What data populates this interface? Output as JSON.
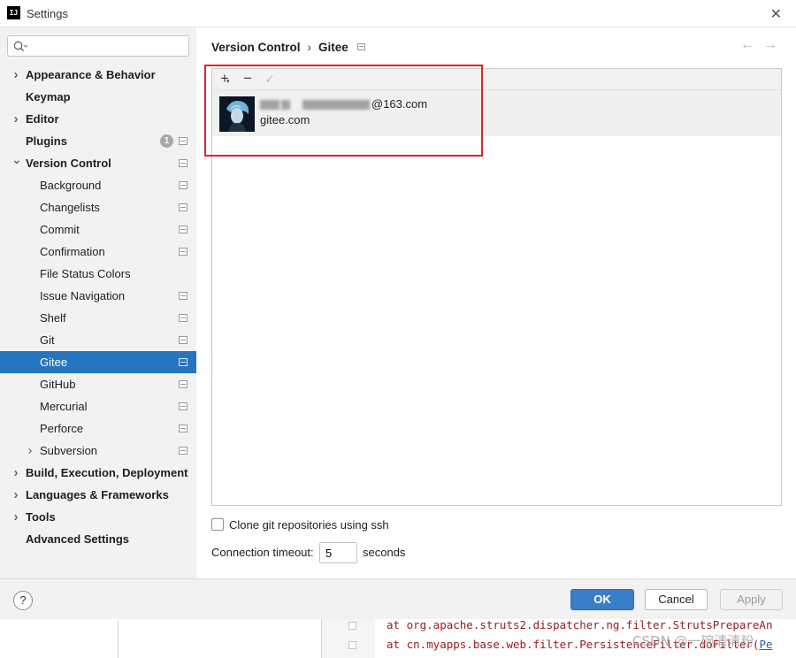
{
  "window": {
    "title": "Settings",
    "logo_text": "IJ"
  },
  "sidebar": {
    "search_placeholder": "",
    "items": [
      {
        "label": "Appearance & Behavior",
        "level": 0,
        "bold": true,
        "expandable": true,
        "expanded": false
      },
      {
        "label": "Keymap",
        "level": 0,
        "bold": true
      },
      {
        "label": "Editor",
        "level": 0,
        "bold": true,
        "expandable": true,
        "expanded": false
      },
      {
        "label": "Plugins",
        "level": 0,
        "bold": true,
        "badge": "1",
        "project": true
      },
      {
        "label": "Version Control",
        "level": 0,
        "bold": true,
        "expandable": true,
        "expanded": true,
        "project": true
      },
      {
        "label": "Background",
        "level": 1,
        "project": true
      },
      {
        "label": "Changelists",
        "level": 1,
        "project": true
      },
      {
        "label": "Commit",
        "level": 1,
        "project": true
      },
      {
        "label": "Confirmation",
        "level": 1,
        "project": true
      },
      {
        "label": "File Status Colors",
        "level": 1
      },
      {
        "label": "Issue Navigation",
        "level": 1,
        "project": true
      },
      {
        "label": "Shelf",
        "level": 1,
        "project": true
      },
      {
        "label": "Git",
        "level": 1,
        "project": true
      },
      {
        "label": "Gitee",
        "level": 1,
        "project": true,
        "selected": true
      },
      {
        "label": "GitHub",
        "level": 1,
        "project": true
      },
      {
        "label": "Mercurial",
        "level": 1,
        "project": true
      },
      {
        "label": "Perforce",
        "level": 1,
        "project": true
      },
      {
        "label": "Subversion",
        "level": 1,
        "expandable": true,
        "expanded": false,
        "project": true
      },
      {
        "label": "Build, Execution, Deployment",
        "level": 0,
        "bold": true,
        "expandable": true,
        "expanded": false
      },
      {
        "label": "Languages & Frameworks",
        "level": 0,
        "bold": true,
        "expandable": true,
        "expanded": false
      },
      {
        "label": "Tools",
        "level": 0,
        "bold": true,
        "expandable": true,
        "expanded": false
      },
      {
        "label": "Advanced Settings",
        "level": 0,
        "bold": true
      }
    ]
  },
  "breadcrumb": {
    "parent": "Version Control",
    "separator": "›",
    "current": "Gitee"
  },
  "accounts": {
    "toolbar": {
      "add": "+",
      "remove": "−",
      "apply": "✓"
    },
    "items": [
      {
        "email_suffix": "@163.com",
        "server": "gitee.com"
      }
    ]
  },
  "options": {
    "clone_ssh_label": "Clone git repositories using ssh",
    "clone_ssh_checked": false,
    "timeout_label": "Connection timeout:",
    "timeout_value": "5",
    "timeout_unit": "seconds"
  },
  "footer": {
    "help": "?",
    "ok": "OK",
    "cancel": "Cancel",
    "apply": "Apply"
  },
  "background_ide": {
    "line1": "at org.apache.struts2.dispatcher.ng.filter.StrutsPrepareAn",
    "line2_prefix": "at cn.myapps.base.web.filter.PersistenceFilter.doFilter(",
    "line2_link": "Pe"
  },
  "watermark": "CSDN @一碗清清粉",
  "colors": {
    "selection": "#2675bf",
    "ok_button": "#3a7fc9",
    "highlight_box": "#d9262b"
  },
  "icons": {
    "search": "search-icon",
    "back": "arrow-left-icon",
    "forward": "arrow-right-icon",
    "help": "help-icon"
  }
}
